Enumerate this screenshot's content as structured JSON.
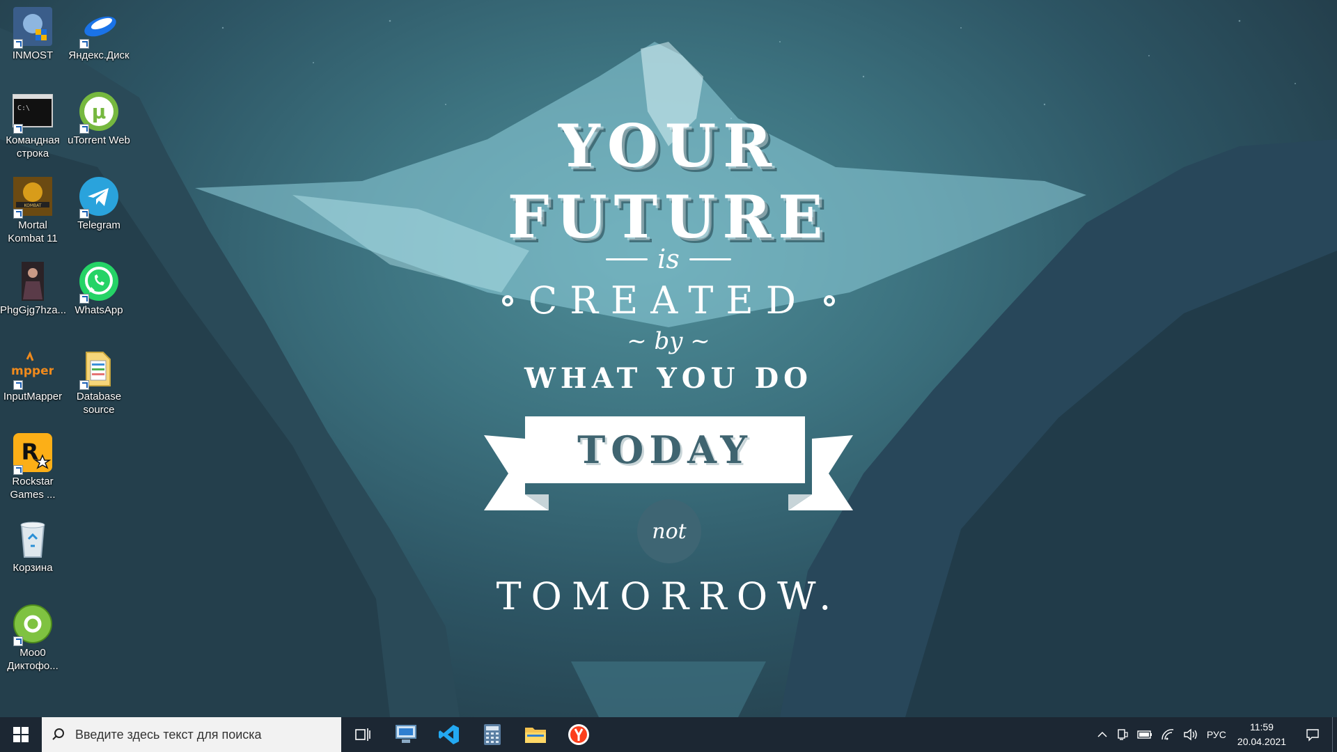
{
  "quote": {
    "line1": "YOUR",
    "line2": "FUTURE",
    "is": "is",
    "created": "CREATED",
    "by": "~ by ~",
    "what_you_do": "WHAT YOU DO",
    "today": "TODAY",
    "not": "not",
    "tomorrow": "TOMORROW."
  },
  "desktop_icons": [
    {
      "label": "INMOST",
      "icon": "inmost-game-icon"
    },
    {
      "label": "Яндекс.Диск",
      "icon": "yandex-disk-icon"
    },
    {
      "label": "Командная строка",
      "icon": "command-prompt-icon"
    },
    {
      "label": "uTorrent Web",
      "icon": "utorrent-icon"
    },
    {
      "label": "Mortal Kombat 11",
      "icon": "mortal-kombat-icon"
    },
    {
      "label": "Telegram",
      "icon": "telegram-icon"
    },
    {
      "label": "PhgGjg7hza...",
      "icon": "image-file-icon"
    },
    {
      "label": "WhatsApp",
      "icon": "whatsapp-icon"
    },
    {
      "label": "InputMapper",
      "icon": "inputmapper-icon"
    },
    {
      "label": "Database source",
      "icon": "database-folder-icon"
    },
    {
      "label": "Rockstar Games ...",
      "icon": "rockstar-icon"
    },
    {
      "label": "Корзина",
      "icon": "recycle-bin-icon"
    },
    {
      "label": "Moo0 Диктофо...",
      "icon": "moo0-recorder-icon"
    }
  ],
  "taskbar": {
    "search_placeholder": "Введите здесь текст для поиска",
    "apps": [
      "task-view-icon",
      "remote-desktop-icon",
      "vscode-icon",
      "calculator-icon",
      "file-explorer-icon",
      "yandex-browser-icon"
    ],
    "language": "РУС",
    "time": "11:59",
    "date": "20.04.2021"
  },
  "colors": {
    "taskbar_bg": "#1c2733",
    "ribbon_text": "#3f6470",
    "not_circle": "#3e6573"
  }
}
